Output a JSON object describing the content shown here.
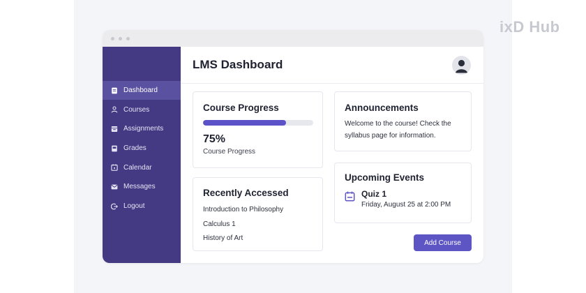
{
  "watermark": "ixD Hub",
  "header": {
    "title": "LMS Dashboard"
  },
  "sidebar": {
    "items": [
      {
        "label": "Dashboard",
        "icon": "document-icon",
        "active": true
      },
      {
        "label": "Courses",
        "icon": "user-icon",
        "active": false
      },
      {
        "label": "Assignments",
        "icon": "tray-icon",
        "active": false
      },
      {
        "label": "Grades",
        "icon": "book-icon",
        "active": false
      },
      {
        "label": "Calendar",
        "icon": "calendar-icon",
        "active": false
      },
      {
        "label": "Messages",
        "icon": "mail-icon",
        "active": false
      },
      {
        "label": "Logout",
        "icon": "logout-icon",
        "active": false
      }
    ]
  },
  "progress": {
    "title": "Course Progress",
    "percent": 75,
    "value_text": "75%",
    "label": "Course Progress"
  },
  "recent": {
    "title": "Recently Accessed",
    "items": [
      "Introduction to Philosophy",
      "Calculus 1",
      "History of Art"
    ]
  },
  "announcements": {
    "title": "Announcements",
    "text": "Welcome to the course! Check the syllabus page for information."
  },
  "events": {
    "title": "Upcoming Events",
    "items": [
      {
        "title": "Quiz 1",
        "date": "Friday, August 25 at 2:00 PM",
        "icon": "calendar-icon"
      }
    ]
  },
  "actions": {
    "add_course": "Add Course"
  },
  "colors": {
    "sidebar": "#433a83",
    "sidebar_active": "#5a51a0",
    "accent": "#5e55c4",
    "progress_fill": "#5c52c8"
  }
}
